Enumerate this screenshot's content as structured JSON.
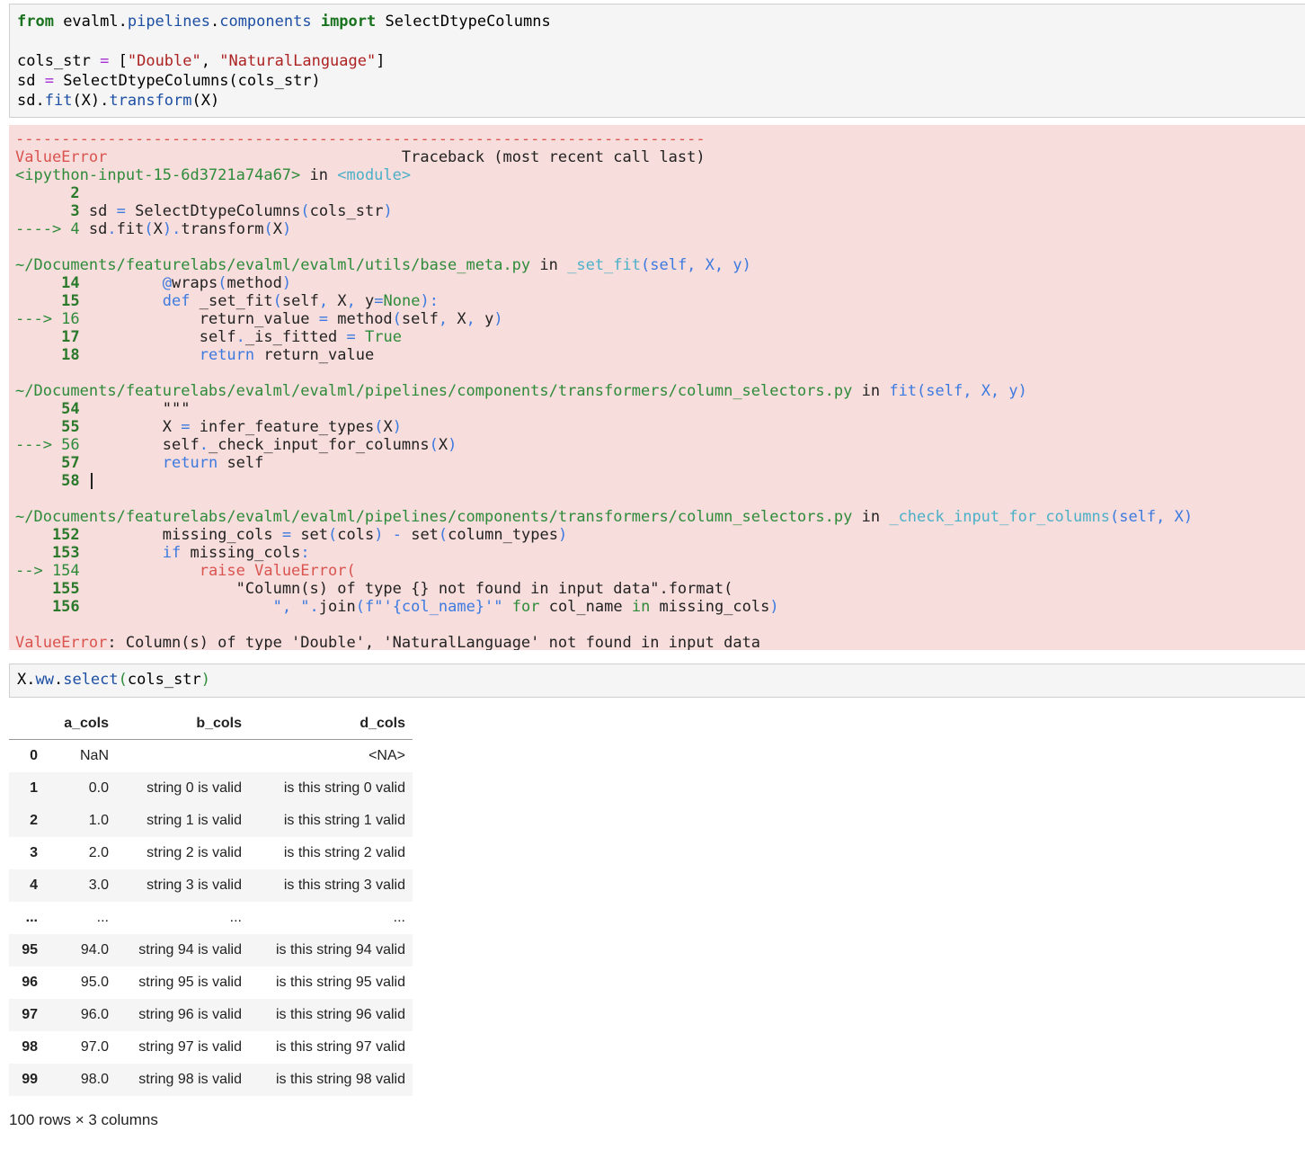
{
  "cell1": {
    "l1_kw_from": "from",
    "l1_mod1": " evalml.",
    "l1_mod2": "pipelines",
    "l1_dot": ".",
    "l1_mod3": "components",
    "l1_sp": " ",
    "l1_kw_import": "import",
    "l1_name": " SelectDtypeColumns",
    "l3_a": "cols_str ",
    "l3_eq": "=",
    "l3_b": " [",
    "l3_s1": "\"Double\"",
    "l3_c": ", ",
    "l3_s2": "\"NaturalLanguage\"",
    "l3_d": "]",
    "l4_a": "sd ",
    "l4_eq": "=",
    "l4_b": " SelectDtypeColumns(cols_str)",
    "l5_a": "sd.",
    "l5_fit": "fit",
    "l5_b": "(X).",
    "l5_tr": "transform",
    "l5_c": "(X)"
  },
  "traceback": {
    "dashes": "---------------------------------------------------------------------------",
    "err_name": "ValueError",
    "header_gap": "                                ",
    "header_text": "Traceback (most recent call last)",
    "f0_file": "<ipython-input-15-6d3721a74a67>",
    "f0_in": " in ",
    "f0_func": "<module>",
    "f0_l2_num": "      2",
    "f0_l3_num": "      3",
    "f0_l3_a": " sd ",
    "f0_l3_eq": "=",
    "f0_l3_b": " SelectDtypeColumns",
    "f0_l3_c": "(",
    "f0_l3_d": "cols_str",
    "f0_l3_e": ")",
    "f0_l4_arrow": "----> 4",
    "f0_l4_a": " sd",
    "f0_l4_b": ".",
    "f0_l4_c": "fit",
    "f0_l4_d": "(",
    "f0_l4_e": "X",
    "f0_l4_f": ")",
    "f0_l4_g": ".",
    "f0_l4_h": "transform",
    "f0_l4_i": "(",
    "f0_l4_j": "X",
    "f0_l4_k": ")",
    "f1_file": "~/Documents/featurelabs/evalml/evalml/utils/base_meta.py",
    "f1_in": " in ",
    "f1_func": "_set_fit",
    "f1_args": "(self, X, y)",
    "f1_l14": "     14",
    "f1_l14_a": "         ",
    "f1_l14_b": "@",
    "f1_l14_c": "wraps",
    "f1_l14_d": "(",
    "f1_l14_e": "method",
    "f1_l14_f": ")",
    "f1_l15": "     15",
    "f1_l15_a": "         ",
    "f1_l15_b": "def",
    "f1_l15_c": " _set_fit",
    "f1_l15_d": "(",
    "f1_l15_e": "self",
    "f1_l15_f": ",",
    "f1_l15_g": " X",
    "f1_l15_h": ",",
    "f1_l15_i": " y",
    "f1_l15_j": "=",
    "f1_l15_k": "None",
    "f1_l15_l": "):",
    "f1_l16": "---> 16",
    "f1_l16_a": "             return_value ",
    "f1_l16_b": "=",
    "f1_l16_c": " method",
    "f1_l16_d": "(",
    "f1_l16_e": "self",
    "f1_l16_f": ",",
    "f1_l16_g": " X",
    "f1_l16_h": ",",
    "f1_l16_i": " y",
    "f1_l16_j": ")",
    "f1_l17": "     17",
    "f1_l17_a": "             self",
    "f1_l17_b": ".",
    "f1_l17_c": "_is_fitted ",
    "f1_l17_d": "=",
    "f1_l17_e": " True",
    "f1_l18": "     18",
    "f1_l18_a": "             ",
    "f1_l18_b": "return",
    "f1_l18_c": " return_value",
    "f2_file": "~/Documents/featurelabs/evalml/evalml/pipelines/components/transformers/column_selectors.py",
    "f2_in": " in ",
    "f2_func": "fit",
    "f2_args": "(self, X, y)",
    "f2_l54": "     54",
    "f2_l54_a": "         \"\"\"",
    "f2_l55": "     55",
    "f2_l55_a": "         X ",
    "f2_l55_b": "=",
    "f2_l55_c": " infer_feature_types",
    "f2_l55_d": "(",
    "f2_l55_e": "X",
    "f2_l55_f": ")",
    "f2_l56": "---> 56",
    "f2_l56_a": "         self",
    "f2_l56_b": ".",
    "f2_l56_c": "_check_input_for_columns",
    "f2_l56_d": "(",
    "f2_l56_e": "X",
    "f2_l56_f": ")",
    "f2_l57": "     57",
    "f2_l57_a": "         ",
    "f2_l57_b": "return",
    "f2_l57_c": " self",
    "f2_l58": "     58",
    "f3_file": "~/Documents/featurelabs/evalml/evalml/pipelines/components/transformers/column_selectors.py",
    "f3_in": " in ",
    "f3_func": "_check_input_for_columns",
    "f3_args": "(self, X)",
    "f3_l152": "    152",
    "f3_l152_a": "         missing_cols ",
    "f3_l152_b": "=",
    "f3_l152_c": " set",
    "f3_l152_d": "(",
    "f3_l152_e": "cols",
    "f3_l152_f": ")",
    "f3_l152_g": " -",
    "f3_l152_h": " set",
    "f3_l152_i": "(",
    "f3_l152_j": "column_types",
    "f3_l152_k": ")",
    "f3_l153": "    153",
    "f3_l153_a": "         ",
    "f3_l153_b": "if",
    "f3_l153_c": " missing_cols",
    "f3_l153_d": ":",
    "f3_l154": "--> 154",
    "f3_l154_a": "             raise ValueError(",
    "f3_l155": "    155",
    "f3_l155_a": "                 \"Column(s) of type {} not found in input data\".format(",
    "f3_l156": "    156",
    "f3_l156_a": "                     \", \"",
    "f3_l156_b": ".",
    "f3_l156_c": "join",
    "f3_l156_d": "(",
    "f3_l156_e": "f\"'{col_name}'\"",
    "f3_l156_f": " for",
    "f3_l156_g": " col_name",
    "f3_l156_h": " in",
    "f3_l156_i": " missing_cols",
    "f3_l156_j": ")",
    "final_name": "ValueError",
    "final_msg": ": Column(s) of type 'Double', 'NaturalLanguage' not found in input data"
  },
  "cell2": {
    "a": "X.",
    "ww": "ww",
    "b": ".",
    "sel": "select",
    "c": "(",
    "d": "cols_str",
    "e": ")"
  },
  "dataframe": {
    "columns": [
      "",
      "a_cols",
      "b_cols",
      "d_cols"
    ],
    "rows": [
      [
        "0",
        "NaN",
        "",
        "<NA>"
      ],
      [
        "1",
        "0.0",
        "string 0 is valid",
        "is this string 0 valid"
      ],
      [
        "2",
        "1.0",
        "string 1 is valid",
        "is this string 1 valid"
      ],
      [
        "3",
        "2.0",
        "string 2 is valid",
        "is this string 2 valid"
      ],
      [
        "4",
        "3.0",
        "string 3 is valid",
        "is this string 3 valid"
      ],
      [
        "...",
        "...",
        "...",
        "..."
      ],
      [
        "95",
        "94.0",
        "string 94 is valid",
        "is this string 94 valid"
      ],
      [
        "96",
        "95.0",
        "string 95 is valid",
        "is this string 95 valid"
      ],
      [
        "97",
        "96.0",
        "string 96 is valid",
        "is this string 96 valid"
      ],
      [
        "98",
        "97.0",
        "string 97 is valid",
        "is this string 97 valid"
      ],
      [
        "99",
        "98.0",
        "string 98 is valid",
        "is this string 98 valid"
      ]
    ],
    "footer": "100 rows × 3 columns"
  }
}
